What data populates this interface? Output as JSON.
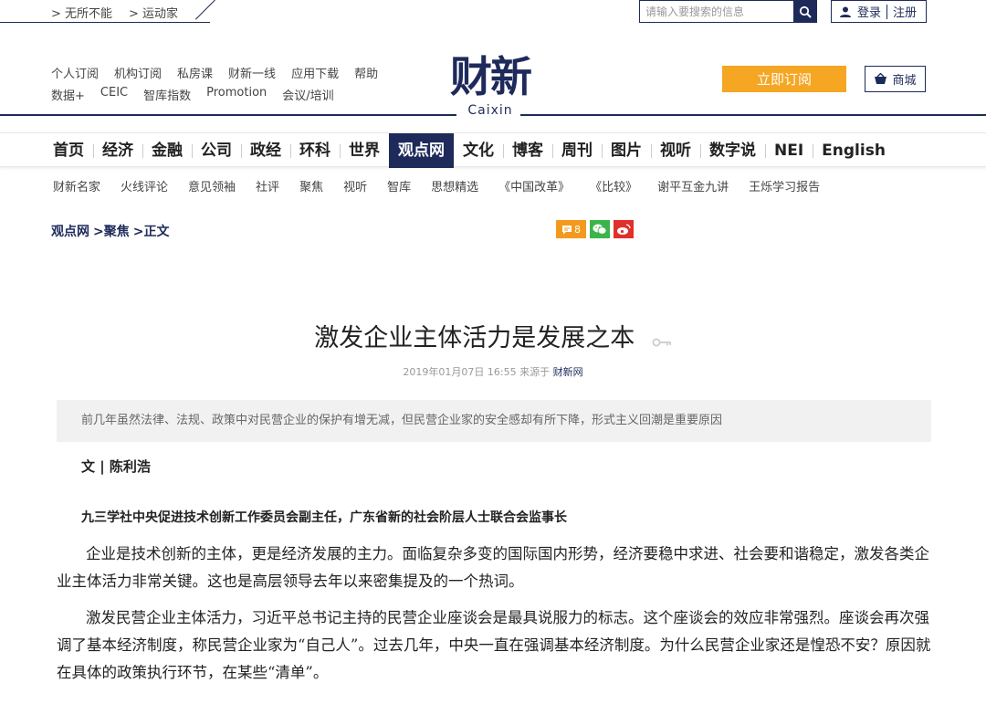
{
  "top": {
    "links": [
      "> 无所不能",
      "> 运动家"
    ],
    "search_placeholder": "请输入要搜索的信息",
    "login": "登录",
    "register": "注册"
  },
  "header": {
    "links_row1": [
      "个人订阅",
      "机构订阅",
      "私房课",
      "财新一线",
      "应用下载",
      "帮助"
    ],
    "links_row2": [
      "数据+",
      "CEIC",
      "智库指数",
      "Promotion",
      "会议/培训"
    ],
    "logo_cn": "财新",
    "logo_en": "Caixin",
    "subscribe": "立即订阅",
    "shop": "商城"
  },
  "main_nav": [
    "首页",
    "经济",
    "金融",
    "公司",
    "政经",
    "环科",
    "世界",
    "观点网",
    "文化",
    "博客",
    "周刊",
    "图片",
    "视听",
    "数字说",
    "NEI",
    "English"
  ],
  "main_nav_active": "观点网",
  "section_nav": [
    "财新名家",
    "火线评论",
    "意见领袖",
    "社评",
    "聚焦",
    "视听",
    "智库",
    "思想精选",
    "《中国改革》",
    "《比较》",
    "谢平互金九讲",
    "王烁学习报告"
  ],
  "breadcrumb": [
    "观点网",
    ">聚焦",
    ">正文"
  ],
  "share": {
    "comment_count": "8"
  },
  "article": {
    "title": "激发企业主体活力是发展之本",
    "date": "2019年01月07日  16:55",
    "source_prefix": "来源于",
    "source": "财新网",
    "summary": "前几年虽然法律、法规、政策中对民营企业的保护有增无减，但民营企业家的安全感却有所下降，形式主义回潮是重要原因",
    "author": "文 | 陈利浩",
    "author_title": "九三学社中央促进技术创新工作委员会副主任，广东省新的社会阶层人士联合会监事长",
    "para1": "企业是技术创新的主体，更是经济发展的主力。面临复杂多变的国际国内形势，经济要稳中求进、社会要和谐稳定，激发各类企业主体活力非常关键。这也是高层领导去年以来密集提及的一个热词。",
    "para2": "激发民营企业主体活力，习近平总书记主持的民营企业座谈会是最具说服力的标志。这个座谈会的效应非常强烈。座谈会再次强调了基本经济制度，称民营企业家为“自己人”。过去几年，中央一直在强调基本经济制度。为什么民营企业家还是惶恐不安？原因就在具体的政策执行环节，在某些“清单”。"
  },
  "colors": {
    "brand": "#1e2a5a",
    "accent": "#f5a623",
    "wechat": "#3bb54a",
    "weibo": "#e0302a",
    "comment": "#f39a1e"
  }
}
